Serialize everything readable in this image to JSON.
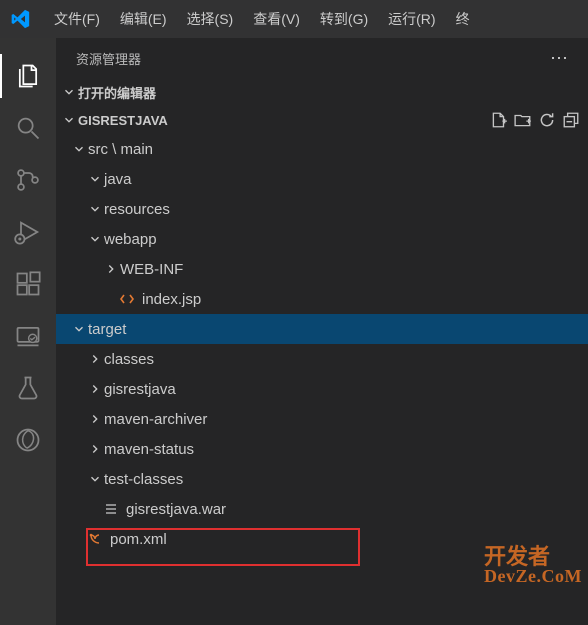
{
  "menu": {
    "file": "文件(F)",
    "edit": "编辑(E)",
    "select": "选择(S)",
    "view": "查看(V)",
    "go": "转到(G)",
    "run": "运行(R)",
    "terminal": "终"
  },
  "explorer": {
    "title": "资源管理器",
    "openEditors": "打开的编辑器",
    "workspaceName": "GISRESTJAVA"
  },
  "tree": {
    "srcMain": "src \\ main",
    "java": "java",
    "resources": "resources",
    "webapp": "webapp",
    "webinf": "WEB-INF",
    "indexjsp": "index.jsp",
    "target": "target",
    "classes": "classes",
    "gisrestjava": "gisrestjava",
    "mavenArchiver": "maven-archiver",
    "mavenStatus": "maven-status",
    "testClasses": "test-classes",
    "gisrestjavaWar": "gisrestjava.war",
    "pomxml": "pom.xml"
  },
  "watermark": {
    "cn": "开发者",
    "en": "DevZe.CoM"
  },
  "colors": {
    "orange": "#ce6a24",
    "jspOrange": "#e37933"
  }
}
